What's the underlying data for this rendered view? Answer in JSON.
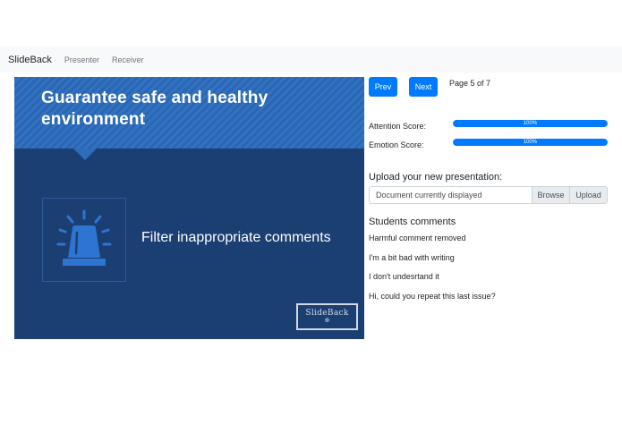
{
  "navbar": {
    "brand": "SlideBack",
    "links": [
      "Presenter",
      "Receiver"
    ]
  },
  "slide": {
    "title": "Guarantee safe and healthy environment",
    "body_text": "Filter inappropriate comments",
    "icon": "siren-alarm-icon",
    "logo_text": "SlideBack",
    "colors": {
      "header": "#2a66b3",
      "background": "#1c3f73",
      "icon": "#2d75d1"
    }
  },
  "controls": {
    "prev_label": "Prev",
    "next_label": "Next",
    "page_indicator": "Page 5 of 7"
  },
  "scores": [
    {
      "label": "Attention Score:",
      "value_text": "100%",
      "value": 100
    },
    {
      "label": "Emotion Score:",
      "value_text": "100%",
      "value": 100
    }
  ],
  "upload": {
    "heading": "Upload your new presentation:",
    "field_value": "Document currently displayed",
    "browse_label": "Browse",
    "upload_label": "Upload"
  },
  "comments": {
    "heading": "Students comments",
    "items": [
      "Harmful comment removed",
      "I'm a bit bad with writing",
      "I don't undesrtand it",
      "Hi, could you repeat this last issue?"
    ]
  },
  "accent_color": "#007bff"
}
